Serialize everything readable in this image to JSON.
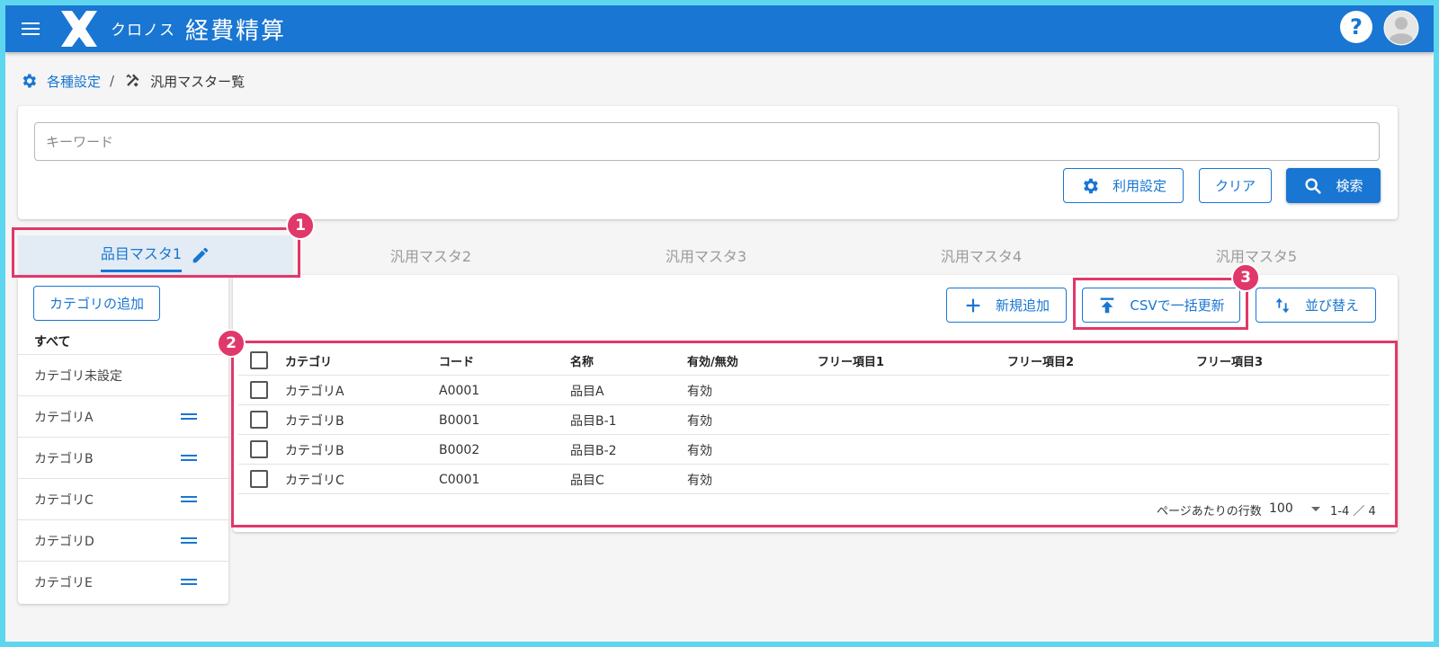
{
  "header": {
    "brand": "クロノス",
    "title": "経費精算",
    "color": "#1976d2"
  },
  "breadcrumb": {
    "parent": "各種設定",
    "separator": "/",
    "current": "汎用マスター覧"
  },
  "search": {
    "placeholder": "キーワード",
    "settings_label": "利用設定",
    "clear_label": "クリア",
    "search_label": "検索"
  },
  "tabs": [
    {
      "label": "品目マスタ1",
      "active": true
    },
    {
      "label": "汎用マスタ2"
    },
    {
      "label": "汎用マスタ3"
    },
    {
      "label": "汎用マスタ4"
    },
    {
      "label": "汎用マスタ5"
    }
  ],
  "categories": {
    "add_label": "カテゴリの追加",
    "all_label": "すべて",
    "items": [
      "カテゴリ未設定",
      "カテゴリA",
      "カテゴリB",
      "カテゴリC",
      "カテゴリD",
      "カテゴリE"
    ]
  },
  "toolbar": {
    "add_label": "新規追加",
    "csv_label": "CSVで一括更新",
    "sort_label": "並び替え"
  },
  "table": {
    "columns": [
      "カテゴリ",
      "コード",
      "名称",
      "有効/無効",
      "フリー項目1",
      "フリー項目2",
      "フリー項目3"
    ],
    "rows": [
      [
        "カテゴリA",
        "A0001",
        "品目A",
        "有効",
        "",
        "",
        ""
      ],
      [
        "カテゴリB",
        "B0001",
        "品目B-1",
        "有効",
        "",
        "",
        ""
      ],
      [
        "カテゴリB",
        "B0002",
        "品目B-2",
        "有効",
        "",
        "",
        ""
      ],
      [
        "カテゴリC",
        "C0001",
        "品目C",
        "有効",
        "",
        "",
        ""
      ]
    ]
  },
  "pagination": {
    "rows_per_page_label": "ページあたりの行数",
    "rows_per_page": "100",
    "range": "1-4 ／ 4"
  },
  "annotations": {
    "badge1": "1",
    "badge2": "2",
    "badge3": "3",
    "color": "#e0386a"
  }
}
